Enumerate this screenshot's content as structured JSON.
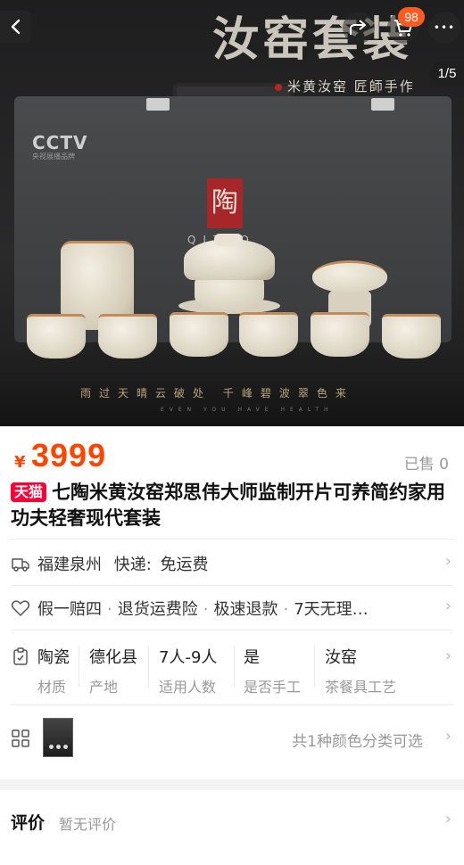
{
  "hero": {
    "title_overlay": "汝窑套装",
    "subtitle": "米黄汝窑 匠師手作",
    "case_logo": "CCTV",
    "case_logo_sub": "央视展播品牌",
    "seal_char": "陶",
    "brand_mark": "QITAO",
    "slogan": "雨过天晴云破处 千峰碧波翠色来",
    "slogan_en": "EVEN YOU HAVE HEALTH",
    "pager": "1/5"
  },
  "nav": {
    "back_icon": "chevron-left-icon",
    "share_icon": "share-icon",
    "cart_icon": "cart-icon",
    "cart_badge": "98",
    "more_icon": "more-dots-icon",
    "more_glyph": "•••"
  },
  "product": {
    "currency": "¥",
    "price": "3999",
    "sold": "已售 0",
    "store_badge": "天猫",
    "title": "七陶米黄汝窑郑思伟大师监制开片可养简约家用功夫轻奢现代套装"
  },
  "shipping": {
    "origin": "福建泉州",
    "label": "快递:",
    "fee": "免运费"
  },
  "services": [
    "假一赔四",
    "退货运费险",
    "极速退款",
    "7天无理…"
  ],
  "params": [
    {
      "value": "陶瓷",
      "key": "材质"
    },
    {
      "value": "德化县",
      "key": "产地"
    },
    {
      "value": "7人-9人",
      "key": "适用人数"
    },
    {
      "value": "是",
      "key": "是否手工"
    },
    {
      "value": "汝窑",
      "key": "茶餐具工艺"
    }
  ],
  "variants": {
    "text": "共1种颜色分类可选"
  },
  "review": {
    "label": "评价",
    "sub": "暂无评价"
  },
  "colors": {
    "price": "#ff4400",
    "tmall": "#ff0036",
    "badge": "#ff5a1f"
  }
}
